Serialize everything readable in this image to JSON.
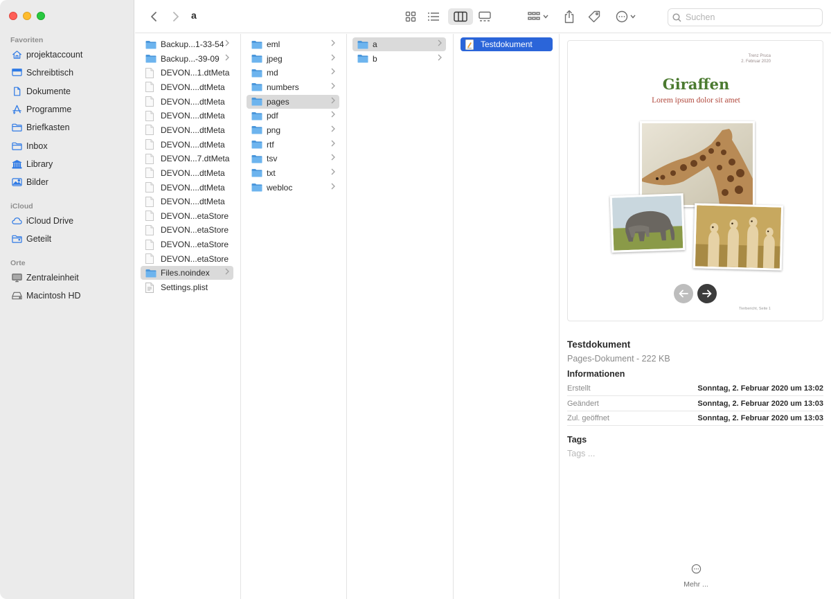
{
  "toolbar": {
    "path_title": "a",
    "search_placeholder": "Suchen"
  },
  "sidebar": {
    "sections": [
      {
        "title": "Favoriten",
        "items": [
          {
            "label": "projektaccount",
            "icon": "home-icon"
          },
          {
            "label": "Schreibtisch",
            "icon": "desktop-icon"
          },
          {
            "label": "Dokumente",
            "icon": "document-icon"
          },
          {
            "label": "Programme",
            "icon": "applications-icon"
          },
          {
            "label": "Briefkasten",
            "icon": "folder-icon"
          },
          {
            "label": "Inbox",
            "icon": "folder-icon"
          },
          {
            "label": "Library",
            "icon": "library-icon"
          },
          {
            "label": "Bilder",
            "icon": "pictures-icon"
          }
        ]
      },
      {
        "title": "iCloud",
        "items": [
          {
            "label": "iCloud Drive",
            "icon": "cloud-icon"
          },
          {
            "label": "Geteilt",
            "icon": "shared-folder-icon"
          }
        ]
      },
      {
        "title": "Orte",
        "items": [
          {
            "label": "Zentraleinheit",
            "icon": "computer-icon"
          },
          {
            "label": "Macintosh HD",
            "icon": "harddisk-icon"
          }
        ]
      }
    ]
  },
  "columns": {
    "col1": [
      {
        "label": "Backup...1-33-54",
        "kind": "folder",
        "chevron": true
      },
      {
        "label": "Backup...-39-09",
        "kind": "folder",
        "chevron": true
      },
      {
        "label": "DEVON...1.dtMeta",
        "kind": "file"
      },
      {
        "label": "DEVON....dtMeta",
        "kind": "file"
      },
      {
        "label": "DEVON....dtMeta",
        "kind": "file"
      },
      {
        "label": "DEVON....dtMeta",
        "kind": "file"
      },
      {
        "label": "DEVON....dtMeta",
        "kind": "file"
      },
      {
        "label": "DEVON....dtMeta",
        "kind": "file"
      },
      {
        "label": "DEVON...7.dtMeta",
        "kind": "file"
      },
      {
        "label": "DEVON....dtMeta",
        "kind": "file"
      },
      {
        "label": "DEVON....dtMeta",
        "kind": "file"
      },
      {
        "label": "DEVON....dtMeta",
        "kind": "file"
      },
      {
        "label": "DEVON...etaStore",
        "kind": "file"
      },
      {
        "label": "DEVON...etaStore",
        "kind": "file"
      },
      {
        "label": "DEVON...etaStore",
        "kind": "file"
      },
      {
        "label": "DEVON...etaStore",
        "kind": "file"
      },
      {
        "label": "Files.noindex",
        "kind": "folder",
        "chevron": true,
        "selected": true
      },
      {
        "label": "Settings.plist",
        "kind": "plist"
      }
    ],
    "col2": [
      {
        "label": "eml",
        "kind": "folder",
        "chevron": true
      },
      {
        "label": "jpeg",
        "kind": "folder",
        "chevron": true
      },
      {
        "label": "md",
        "kind": "folder",
        "chevron": true
      },
      {
        "label": "numbers",
        "kind": "folder",
        "chevron": true
      },
      {
        "label": "pages",
        "kind": "folder",
        "chevron": true,
        "selected": true
      },
      {
        "label": "pdf",
        "kind": "folder",
        "chevron": true
      },
      {
        "label": "png",
        "kind": "folder",
        "chevron": true
      },
      {
        "label": "rtf",
        "kind": "folder",
        "chevron": true
      },
      {
        "label": "tsv",
        "kind": "folder",
        "chevron": true
      },
      {
        "label": "txt",
        "kind": "folder",
        "chevron": true
      },
      {
        "label": "webloc",
        "kind": "folder",
        "chevron": true
      }
    ],
    "col3": [
      {
        "label": "a",
        "kind": "folder",
        "chevron": true,
        "selected": true
      },
      {
        "label": "b",
        "kind": "folder",
        "chevron": true
      }
    ],
    "col4": [
      {
        "label": "Testdokument",
        "kind": "pages",
        "active": true
      }
    ]
  },
  "preview": {
    "doc_author_line1": "Trenz Pruca",
    "doc_author_line2": "2. Februar 2020",
    "doc_title": "Giraffen",
    "doc_subtitle": "Lorem ipsum dolor sit amet",
    "doc_footer": "Tierbericht, Seite 1",
    "name": "Testdokument",
    "kind": "Pages-Dokument - 222 KB",
    "info_heading": "Informationen",
    "info": [
      {
        "key": "Erstellt",
        "value": "Sonntag, 2. Februar 2020 um 13:02"
      },
      {
        "key": "Geändert",
        "value": "Sonntag, 2. Februar 2020 um 13:03"
      },
      {
        "key": "Zul. geöffnet",
        "value": "Sonntag, 2. Februar 2020 um 13:03"
      }
    ],
    "tags_heading": "Tags",
    "tags_placeholder": "Tags ...",
    "more_label": "Mehr ..."
  },
  "colors": {
    "selection_blue": "#2b65d9",
    "folder_blue": "#5fa8e8",
    "sidebar_icon_blue": "#2f7ae5"
  }
}
